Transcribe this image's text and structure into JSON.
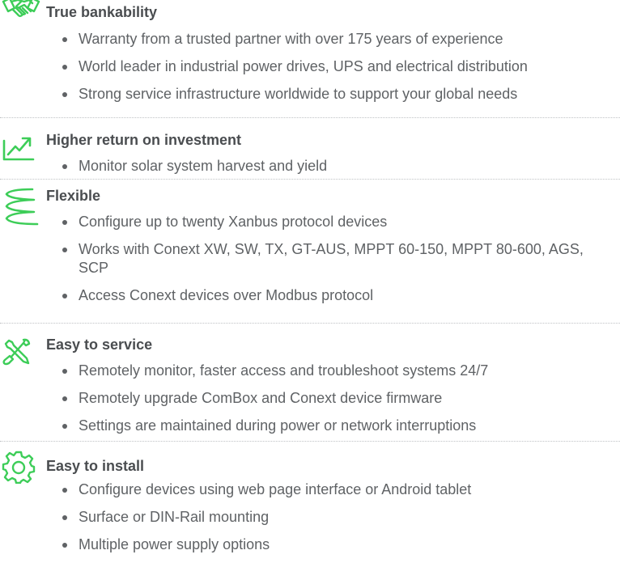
{
  "sections": [
    {
      "icon": "handshake-icon",
      "title": "True bankability",
      "bullets": [
        "Warranty from a trusted partner with over 175 years of experience",
        "World leader in industrial power drives, UPS and electrical distribution",
        "Strong service infrastructure worldwide to support your global needs"
      ]
    },
    {
      "icon": "trend-up-icon",
      "title": "Higher return on investment",
      "bullets": [
        "Monitor solar system harvest and yield"
      ]
    },
    {
      "icon": "spring-coil-icon",
      "title": "Flexible",
      "bullets": [
        "Configure up to twenty Xanbus protocol devices",
        "Works with Conext XW, SW, TX, GT-AUS, MPPT 60-150, MPPT 80-600, AGS, SCP",
        "Access Conext devices over Modbus protocol"
      ]
    },
    {
      "icon": "wrench-screwdriver-icon",
      "title": "Easy to service",
      "bullets": [
        "Remotely monitor, faster access and troubleshoot systems 24/7",
        "Remotely upgrade ComBox and Conext device firmware",
        "Settings are maintained during power or network interruptions"
      ]
    },
    {
      "icon": "gear-icon",
      "title": "Easy to install",
      "bullets": [
        "Configure devices using web page interface or Android tablet",
        "Surface or DIN-Rail mounting",
        "Multiple power supply options"
      ]
    }
  ],
  "colors": {
    "accent": "#3dcd58",
    "text": "#5f6265",
    "heading": "#4a4d50"
  }
}
